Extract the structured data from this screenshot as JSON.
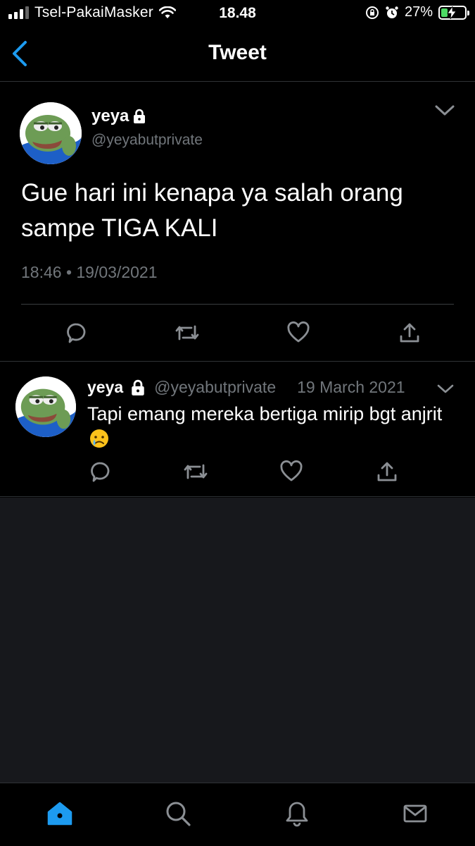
{
  "status_bar": {
    "carrier": "Tsel-PakaiMasker",
    "time": "18.48",
    "battery_percent": "27%",
    "battery_level": 0.27
  },
  "header": {
    "title": "Tweet"
  },
  "main_tweet": {
    "display_name": "yeya",
    "handle": "@yeyabutprivate",
    "text": "Gue hari ini kenapa ya salah orang sampe TIGA KALI",
    "timestamp": "18:46 • 19/03/2021"
  },
  "reply": {
    "display_name": "yeya",
    "handle": "@yeyabutprivate",
    "date": "19 March 2021",
    "text": "Tapi emang mereka bertiga mirip bgt anjrit"
  },
  "tabs": [
    "home-icon",
    "search-icon",
    "notifications-icon",
    "messages-icon"
  ],
  "colors": {
    "accent": "#1d9bf0",
    "background": "#000000",
    "secondary_text": "#71767b",
    "empty_area": "#17181c"
  }
}
